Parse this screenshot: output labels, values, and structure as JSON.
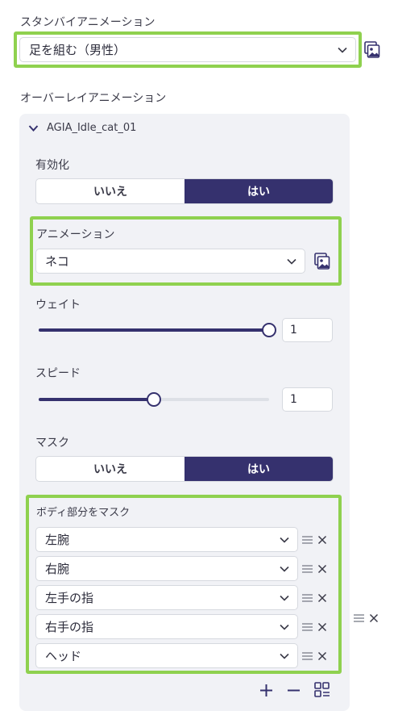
{
  "standby": {
    "label": "スタンバイアニメーション",
    "value": "足を組む（男性）"
  },
  "overlay": {
    "label": "オーバーレイアニメーション",
    "item_title": "AGIA_Idle_cat_01",
    "enabled": {
      "label": "有効化",
      "no": "いいえ",
      "yes": "はい",
      "selected": "はい"
    },
    "animation": {
      "label": "アニメーション",
      "value": "ネコ"
    },
    "weight": {
      "label": "ウェイト",
      "value": "1",
      "level": 1.0
    },
    "speed": {
      "label": "スピード",
      "value": "1",
      "level": 0.5
    },
    "mask": {
      "label": "マスク",
      "no": "いいえ",
      "yes": "はい",
      "selected": "はい"
    },
    "body_mask": {
      "label": "ボディ部分をマスク",
      "items": [
        "左腕",
        "右腕",
        "左手の指",
        "右手の指",
        "ヘッド"
      ]
    }
  },
  "colors": {
    "accent": "#35316e",
    "highlight": "#8fd14f",
    "panel": "#f1f2f6"
  },
  "icons": [
    "chevron-down-icon",
    "image-picker-icon",
    "drag-handle-icon",
    "close-icon",
    "plus-icon",
    "minus-icon",
    "grid-list-icon"
  ]
}
